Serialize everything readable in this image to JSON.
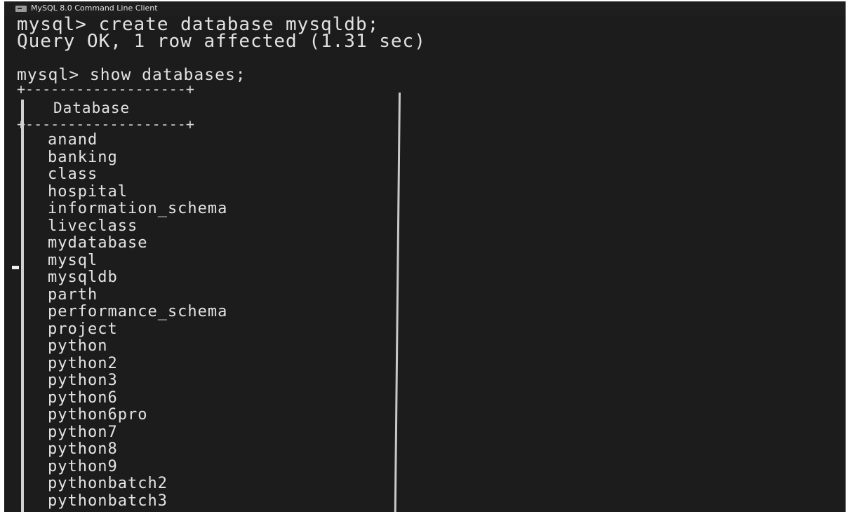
{
  "window": {
    "title": "MySQL 8.0 Command Line Client",
    "icon": "console-icon"
  },
  "terminal": {
    "command_1": "mysql> create database mysqldb;",
    "response_1": "Query OK, 1 row affected (1.31 sec)",
    "command_2": "mysql> show databases;",
    "table_border": "+-------------------+",
    "column_header": "Database",
    "databases": [
      "anand",
      "banking",
      "class",
      "hospital",
      "information_schema",
      "liveclass",
      "mydatabase",
      "mysql",
      "mysqldb",
      "parth",
      "performance_schema",
      "project",
      "python",
      "python2",
      "python3",
      "python6",
      "python6pro",
      "python7",
      "python8",
      "python9",
      "pythonbatch2",
      "pythonbatch3"
    ]
  },
  "colors": {
    "background": "#1c1c1c",
    "text": "#e2e2e2"
  }
}
